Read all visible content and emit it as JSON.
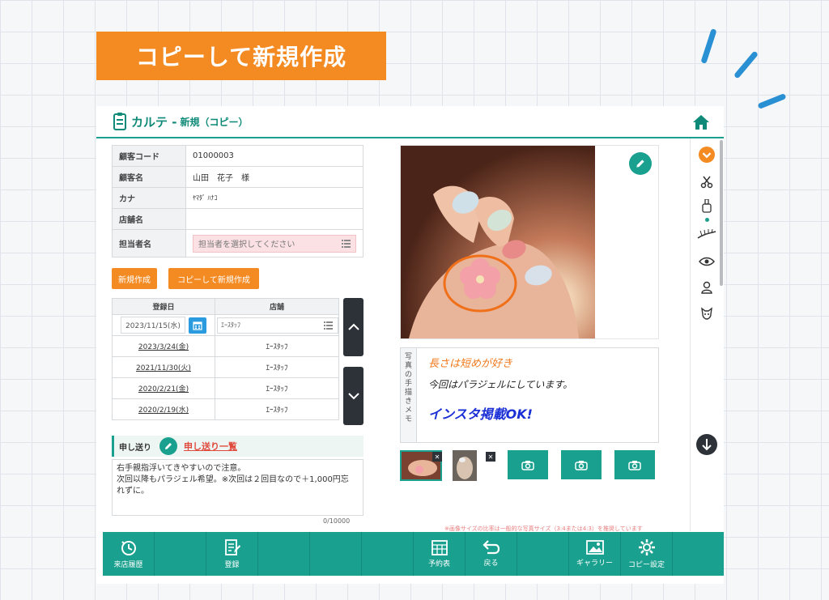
{
  "banner": {
    "text": "コピーして新規作成"
  },
  "header": {
    "title": "カルテ - ",
    "subtitle": "新規（コピー）"
  },
  "customer": {
    "rows": [
      {
        "label": "顧客コード",
        "value": "01000003"
      },
      {
        "label": "顧客名",
        "value": "山田　花子　様"
      },
      {
        "label": "カナ",
        "value": "ﾔﾏﾀﾞ ﾊﾅｺ"
      },
      {
        "label": "店舗名",
        "value": ""
      },
      {
        "label": "担当者名",
        "placeholder": "担当者を選択してください"
      }
    ]
  },
  "actions": {
    "new_label": "新規作成",
    "copy_label": "コピーして新規作成"
  },
  "visits": {
    "headers": [
      "登録日",
      "店舗"
    ],
    "current": {
      "date": "2023/11/15(水)",
      "store": "ｴｰｽﾀｯﾌ"
    },
    "rows": [
      {
        "date": "2023/3/24(金)",
        "store": "ｴｰｽﾀｯﾌ"
      },
      {
        "date": "2021/11/30(火)",
        "store": "ｴｰｽﾀｯﾌ"
      },
      {
        "date": "2020/2/21(金)",
        "store": "ｴｰｽﾀｯﾌ"
      },
      {
        "date": "2020/2/19(水)",
        "store": "ｴｰｽﾀｯﾌ"
      }
    ]
  },
  "handover": {
    "label": "申し送り",
    "link": "申し送り一覧",
    "lines": [
      "右手親指浮いてきやすいので注意。",
      "次回以降もパラジェル希望。※次回は２回目なので＋1,000円忘",
      "れずに。"
    ],
    "counter": "0/10000"
  },
  "hand_memo": {
    "tab": [
      "写",
      "真",
      "の",
      "手",
      "描",
      "き",
      "メ",
      "モ"
    ],
    "line1": "長さは短めが好き",
    "line2": "今回はパラジェルにしています。",
    "line3": "インスタ掲載OK!",
    "colors": {
      "line1": "#f07a1e",
      "line2": "#222222",
      "line3": "#1a2fd6"
    }
  },
  "notice": "※画像サイズの比率は一般的な写真サイズ（3:4または4:3）を推奨しています",
  "bottom_bar": {
    "history": "来店履歴",
    "register": "登録",
    "schedule": "予約表",
    "back": "戻る",
    "gallery": "ギャラリー",
    "copy_settings": "コピー設定"
  },
  "colors": {
    "accent": "#1aa08e",
    "orange": "#f48a22",
    "link_red": "#e04a3c"
  }
}
